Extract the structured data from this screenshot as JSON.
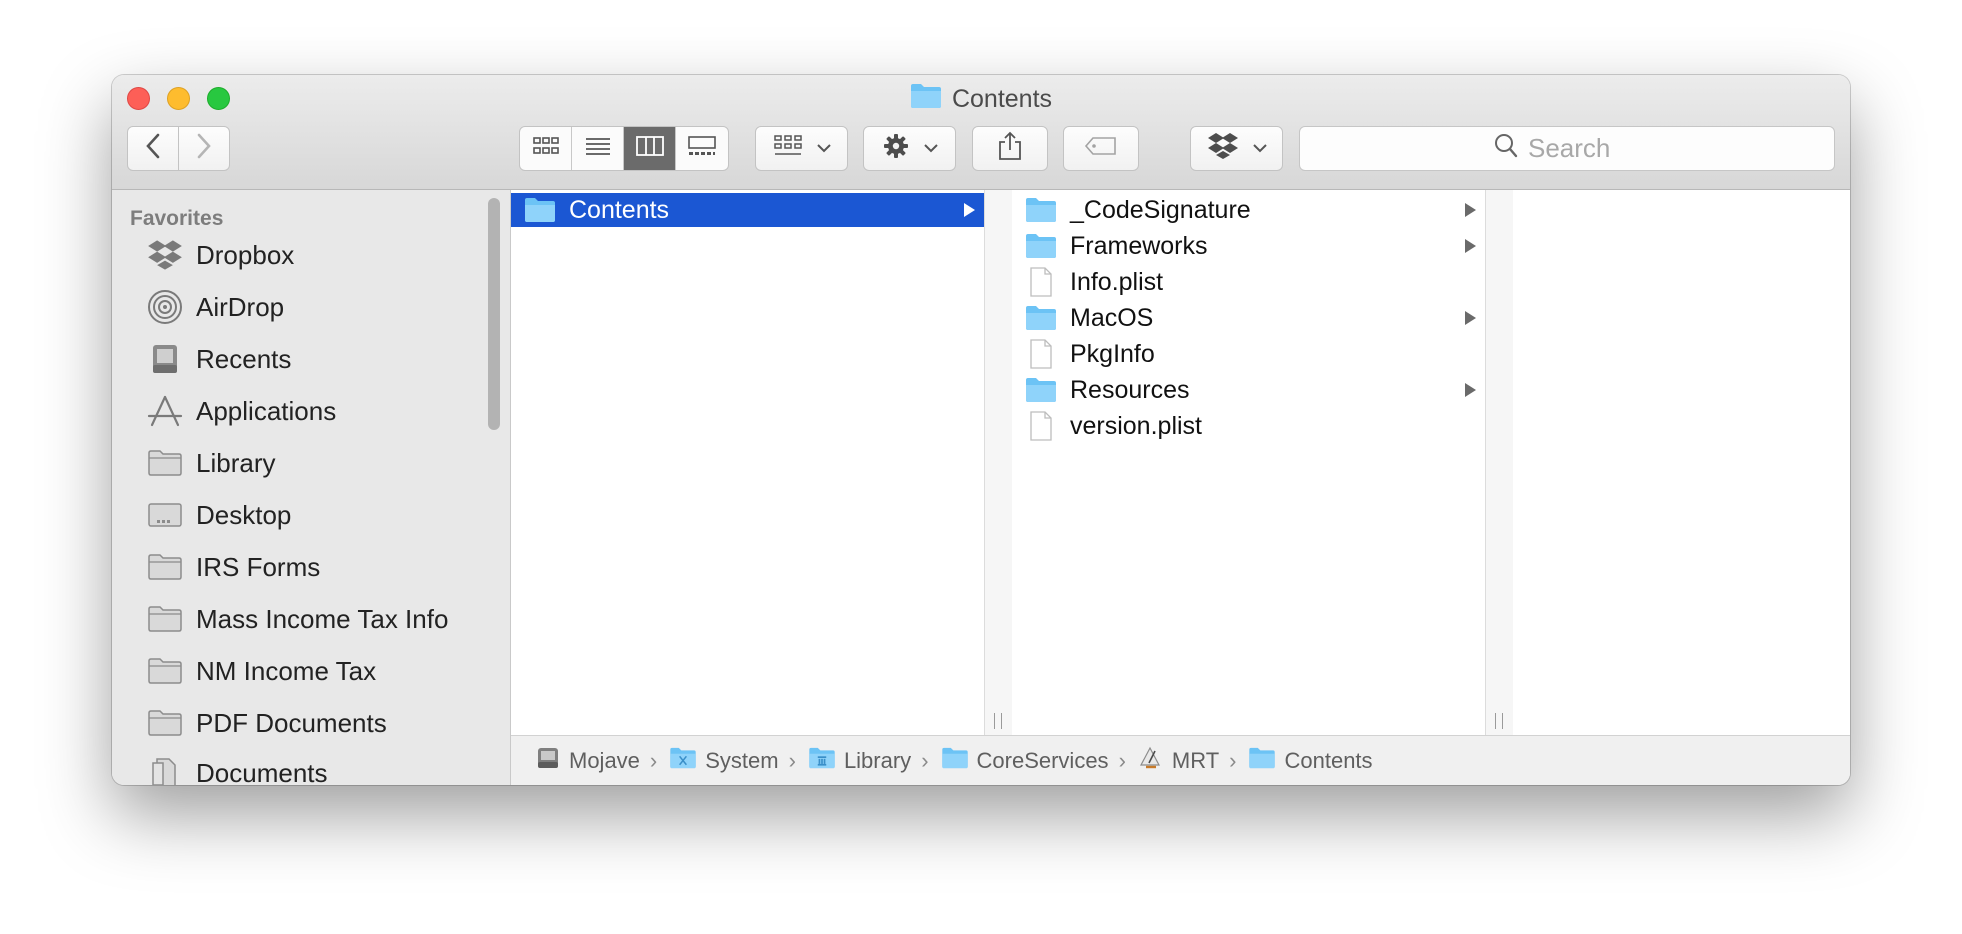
{
  "window": {
    "title": "Contents"
  },
  "toolbar": {
    "search_placeholder": "Search",
    "view_modes": [
      "icon-view",
      "list-view",
      "column-view",
      "gallery-view"
    ],
    "active_view": "column-view"
  },
  "sidebar": {
    "header": "Favorites",
    "items": [
      {
        "label": "Dropbox",
        "icon": "dropbox-icon"
      },
      {
        "label": "AirDrop",
        "icon": "airdrop-icon"
      },
      {
        "label": "Recents",
        "icon": "recents-icon"
      },
      {
        "label": "Applications",
        "icon": "applications-icon"
      },
      {
        "label": "Library",
        "icon": "folder-icon"
      },
      {
        "label": "Desktop",
        "icon": "desktop-icon"
      },
      {
        "label": "IRS Forms",
        "icon": "folder-icon"
      },
      {
        "label": "Mass Income Tax Info",
        "icon": "folder-icon"
      },
      {
        "label": "NM Income Tax",
        "icon": "folder-icon"
      },
      {
        "label": "PDF Documents",
        "icon": "folder-icon"
      },
      {
        "label": "Documents",
        "icon": "documents-icon"
      }
    ]
  },
  "columns": [
    {
      "items": [
        {
          "label": "Contents",
          "type": "folder",
          "selected": true
        }
      ]
    },
    {
      "items": [
        {
          "label": "_CodeSignature",
          "type": "folder"
        },
        {
          "label": "Frameworks",
          "type": "folder"
        },
        {
          "label": "Info.plist",
          "type": "file"
        },
        {
          "label": "MacOS",
          "type": "folder"
        },
        {
          "label": "PkgInfo",
          "type": "file"
        },
        {
          "label": "Resources",
          "type": "folder"
        },
        {
          "label": "version.plist",
          "type": "file"
        }
      ]
    }
  ],
  "pathbar": [
    {
      "label": "Mojave",
      "icon": "disk-icon"
    },
    {
      "label": "System",
      "icon": "system-folder-icon"
    },
    {
      "label": "Library",
      "icon": "library-folder-icon"
    },
    {
      "label": "CoreServices",
      "icon": "folder-icon"
    },
    {
      "label": "MRT",
      "icon": "app-icon"
    },
    {
      "label": "Contents",
      "icon": "folder-icon"
    }
  ],
  "colors": {
    "selection": "#1b57d3",
    "folder": "#6cc3f5",
    "sidebar_bg": "#e8e8e8"
  }
}
